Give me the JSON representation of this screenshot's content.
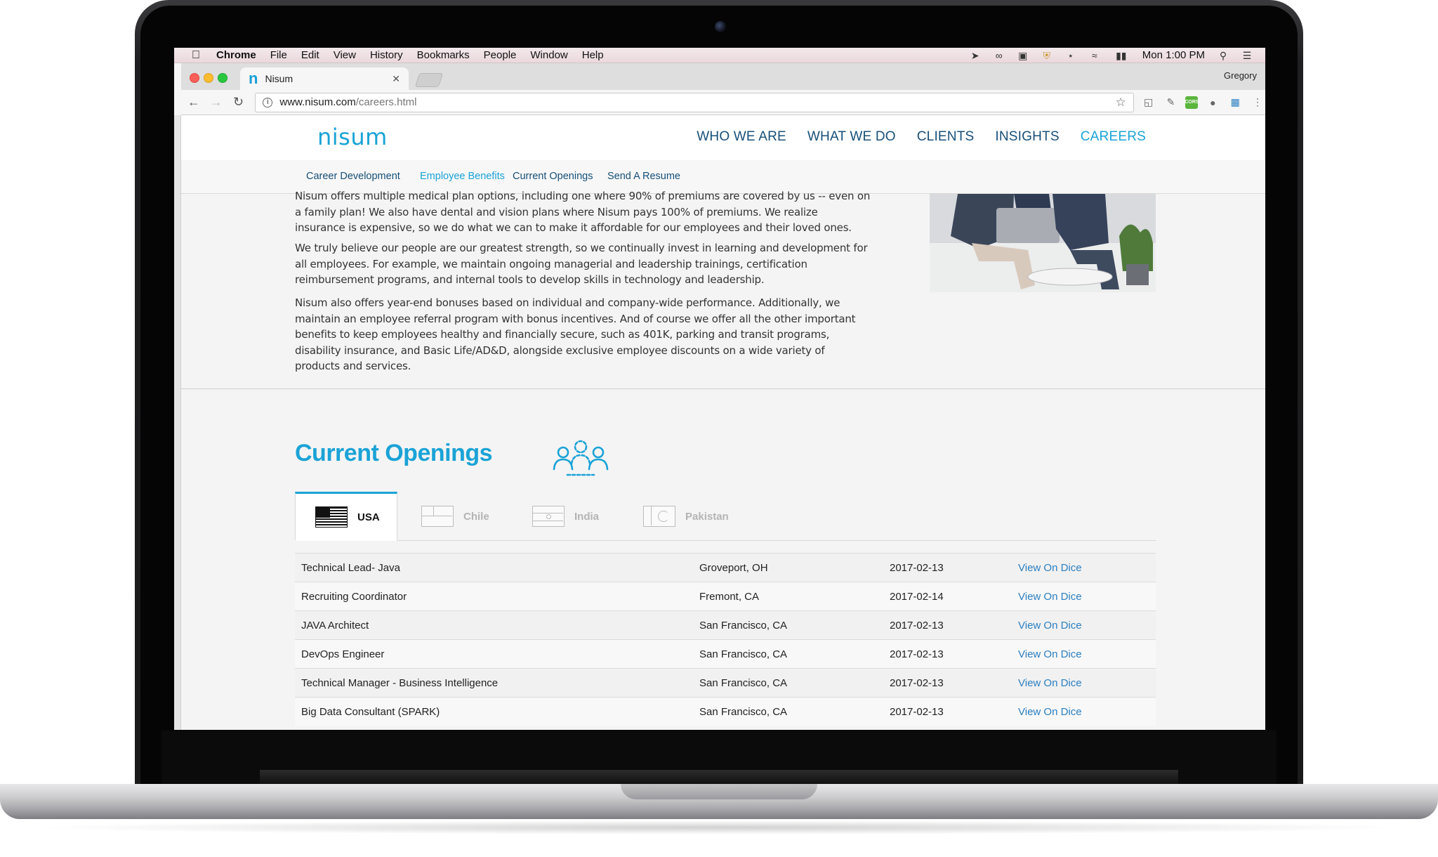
{
  "menubar": {
    "app": "Chrome",
    "items": [
      "File",
      "Edit",
      "View",
      "History",
      "Bookmarks",
      "People",
      "Window",
      "Help"
    ],
    "clock": "Mon 1:00 PM"
  },
  "browser": {
    "tab_title": "Nisum",
    "favicon": "n",
    "profile": "Gregory",
    "url_host": "www.nisum.com",
    "url_path": "/careers.html",
    "ext_cors": "CORS"
  },
  "site": {
    "logo": "nisum",
    "nav": [
      "WHO WE ARE",
      "WHAT WE DO",
      "CLIENTS",
      "INSIGHTS",
      "CAREERS"
    ],
    "subnav": [
      "Career Development",
      "Employee Benefits",
      "Current Openings",
      "Send A Resume"
    ]
  },
  "benefits": {
    "para1": "Nisum offers multiple medical plan options, including one where 90% of premiums are covered by us -- even on a family plan! We also have dental and vision plans where Nisum pays 100% of premiums. We realize insurance is expensive, so we do what we can to make it affordable for our employees and their loved ones.",
    "para2": "We truly believe our people are our greatest strength, so we continually invest in learning and development for all employees. For example, we maintain ongoing managerial and leadership trainings, certification reimbursement programs, and internal tools to develop skills in technology and leadership.",
    "para3": "Nisum also offers year-end bonuses based on individual and company-wide performance. Additionally, we maintain an employee referral program with bonus incentives. And of course we offer all the other important benefits to keep employees healthy and financially secure, such as 401K, parking and transit programs, disability insurance, and Basic Life/AD&D, alongside exclusive employee discounts on a wide variety of products and services."
  },
  "openings": {
    "title": "Current Openings",
    "countries": [
      "USA",
      "Chile",
      "India",
      "Pakistan"
    ],
    "jobs": [
      {
        "title": "Technical Lead- Java",
        "location": "Groveport, OH",
        "date": "2017-02-13",
        "link": "View On Dice"
      },
      {
        "title": "Recruiting Coordinator",
        "location": "Fremont, CA",
        "date": "2017-02-14",
        "link": "View On Dice"
      },
      {
        "title": "JAVA Architect",
        "location": "San Francisco, CA",
        "date": "2017-02-13",
        "link": "View On Dice"
      },
      {
        "title": "DevOps Engineer",
        "location": "San Francisco, CA",
        "date": "2017-02-13",
        "link": "View On Dice"
      },
      {
        "title": "Technical Manager - Business Intelligence",
        "location": "San Francisco, CA",
        "date": "2017-02-13",
        "link": "View On Dice"
      },
      {
        "title": "Big Data Consultant (SPARK)",
        "location": "San Francisco, CA",
        "date": "2017-02-13",
        "link": "View On Dice"
      }
    ]
  },
  "colors": {
    "brand": "#1aa3d6",
    "nav": "#174f78",
    "link": "#2a7fc1"
  }
}
